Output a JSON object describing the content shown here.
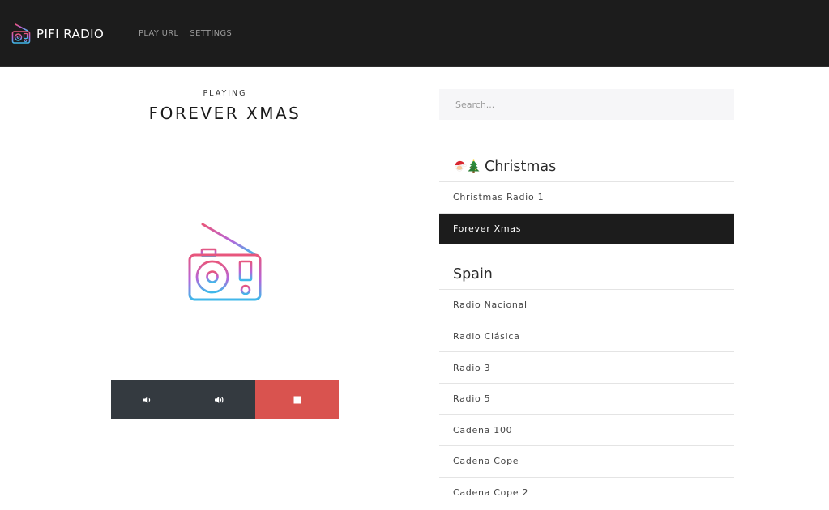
{
  "app": {
    "brand": "PIFI RADIO",
    "nav": [
      {
        "label": "PLAY URL"
      },
      {
        "label": "SETTINGS"
      }
    ]
  },
  "player": {
    "status_label": "PLAYING",
    "station_name": "FOREVER XMAS",
    "art_icon": "radio-icon",
    "controls": {
      "volume_down_icon": "volume-down-icon",
      "volume_up_icon": "volume-up-icon",
      "stop_icon": "stop-icon"
    }
  },
  "search": {
    "placeholder": "Search..."
  },
  "groups": [
    {
      "title": "Christmas",
      "emoji": [
        "santa-emoji",
        "christmas-tree-emoji"
      ],
      "stations": [
        {
          "name": "Christmas Radio 1",
          "active": false
        },
        {
          "name": "Forever Xmas",
          "active": true
        }
      ]
    },
    {
      "title": "Spain",
      "stations": [
        {
          "name": "Radio Nacional",
          "active": false
        },
        {
          "name": "Radio Clásica",
          "active": false
        },
        {
          "name": "Radio 3",
          "active": false
        },
        {
          "name": "Radio 5",
          "active": false
        },
        {
          "name": "Cadena 100",
          "active": false
        },
        {
          "name": "Cadena Cope",
          "active": false
        },
        {
          "name": "Cadena Cope 2",
          "active": false
        }
      ]
    }
  ],
  "colors": {
    "navbar": "#1c1c1c",
    "control_dark": "#343a40",
    "stop": "#d9534f",
    "active_item": "#1c1c1c",
    "gradient_start": "#e8567c",
    "gradient_mid": "#b565d9",
    "gradient_end": "#3fb9ea"
  }
}
